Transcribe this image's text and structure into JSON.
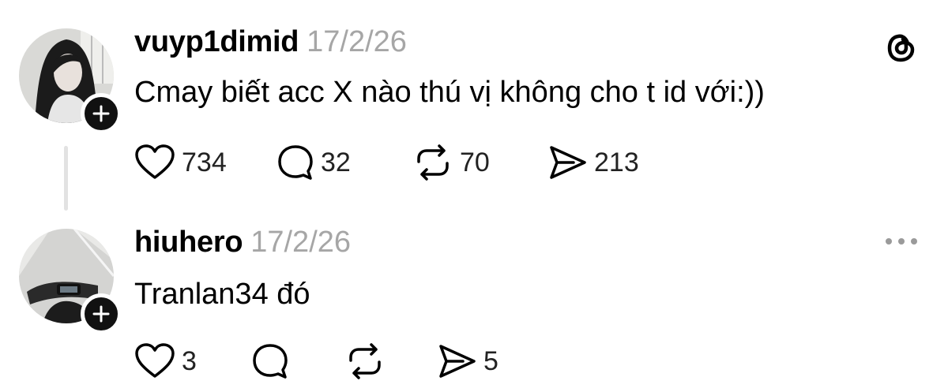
{
  "post": {
    "username": "vuyp1dimid",
    "date": "17/2/26",
    "text": "Cmay biết acc X nào thú vị không cho t id với:))",
    "likes": "734",
    "replies": "32",
    "reposts": "70",
    "shares": "213",
    "app_icon": "threads-logo-icon"
  },
  "reply": {
    "username": "hiuhero",
    "date": "17/2/26",
    "text": "Tranlan34 đó",
    "likes": "3",
    "shares": "5",
    "more_icon": "more-options-icon"
  }
}
